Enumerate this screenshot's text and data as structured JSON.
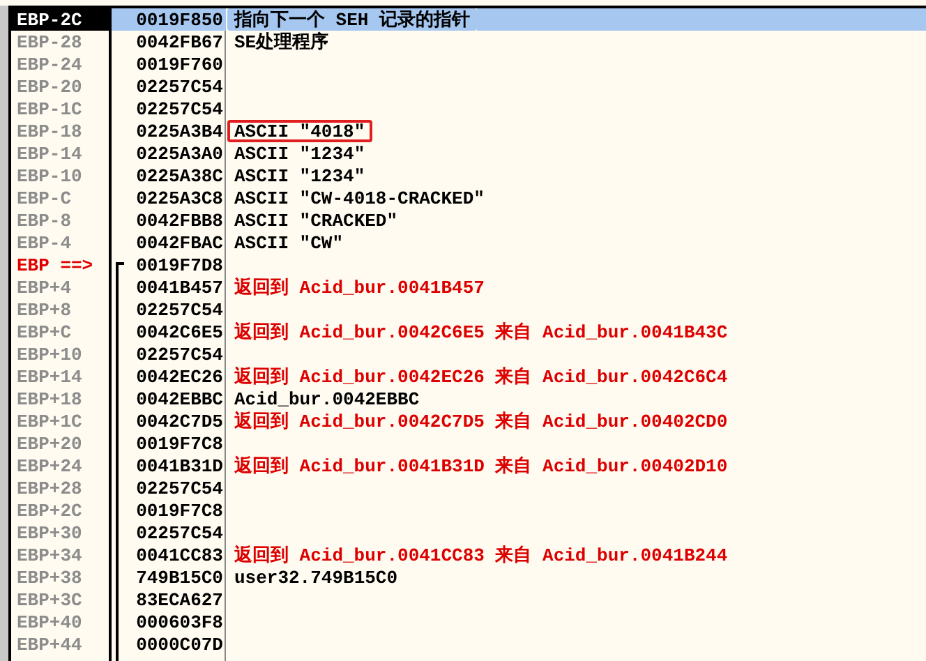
{
  "rows": [
    {
      "label": "EBP-2C",
      "value": "0019F850",
      "comment": "指向下一个 SEH 记录的指针",
      "kind": "plain",
      "selected": true,
      "current": false,
      "boxed": false,
      "frame_start": false
    },
    {
      "label": "EBP-28",
      "value": "0042FB67",
      "comment": "SE处理程序",
      "kind": "plain",
      "selected": false,
      "current": false,
      "boxed": false,
      "frame_start": false
    },
    {
      "label": "EBP-24",
      "value": "0019F760",
      "selected": false,
      "current": false,
      "frame_start": false
    },
    {
      "label": "EBP-20",
      "value": "02257C54",
      "selected": false,
      "current": false,
      "frame_start": false
    },
    {
      "label": "EBP-1C",
      "value": "02257C54",
      "selected": false,
      "current": false,
      "frame_start": false
    },
    {
      "label": "EBP-18",
      "value": "0225A3B4",
      "comment": "ASCII \"4018\"",
      "kind": "plain",
      "selected": false,
      "current": false,
      "boxed": true,
      "frame_start": false
    },
    {
      "label": "EBP-14",
      "value": "0225A3A0",
      "comment": "ASCII \"1234\"",
      "kind": "plain",
      "selected": false,
      "current": false,
      "boxed": false,
      "frame_start": false
    },
    {
      "label": "EBP-10",
      "value": "0225A38C",
      "comment": "ASCII \"1234\"",
      "kind": "plain",
      "selected": false,
      "current": false,
      "boxed": false,
      "frame_start": false
    },
    {
      "label": "EBP-C",
      "value": "0225A3C8",
      "comment": "ASCII \"CW-4018-CRACKED\"",
      "kind": "plain",
      "selected": false,
      "current": false,
      "boxed": false,
      "frame_start": false
    },
    {
      "label": "EBP-8",
      "value": "0042FBB8",
      "comment": "ASCII \"CRACKED\"",
      "kind": "plain",
      "selected": false,
      "current": false,
      "boxed": false,
      "frame_start": false
    },
    {
      "label": "EBP-4",
      "value": "0042FBAC",
      "comment": "ASCII \"CW\"",
      "kind": "plain",
      "selected": false,
      "current": false,
      "boxed": false,
      "frame_start": false
    },
    {
      "label": "EBP ==>",
      "value": "0019F7D8",
      "selected": false,
      "current": true,
      "frame_start": true
    },
    {
      "label": "EBP+4",
      "value": "0041B457",
      "comment": "返回到 Acid_bur.0041B457",
      "kind": "return",
      "selected": false,
      "current": false,
      "boxed": false,
      "frame_start": false
    },
    {
      "label": "EBP+8",
      "value": "02257C54",
      "selected": false,
      "current": false,
      "frame_start": false
    },
    {
      "label": "EBP+C",
      "value": "0042C6E5",
      "comment": "返回到 Acid_bur.0042C6E5 来自 Acid_bur.0041B43C",
      "kind": "return",
      "selected": false,
      "current": false,
      "boxed": false,
      "frame_start": false
    },
    {
      "label": "EBP+10",
      "value": "02257C54",
      "selected": false,
      "current": false,
      "frame_start": false
    },
    {
      "label": "EBP+14",
      "value": "0042EC26",
      "comment": "返回到 Acid_bur.0042EC26 来自 Acid_bur.0042C6C4",
      "kind": "return",
      "selected": false,
      "current": false,
      "boxed": false,
      "frame_start": false
    },
    {
      "label": "EBP+18",
      "value": "0042EBBC",
      "comment": "Acid_bur.0042EBBC",
      "kind": "plain",
      "selected": false,
      "current": false,
      "boxed": false,
      "frame_start": false
    },
    {
      "label": "EBP+1C",
      "value": "0042C7D5",
      "comment": "返回到 Acid_bur.0042C7D5 来自 Acid_bur.00402CD0",
      "kind": "return",
      "selected": false,
      "current": false,
      "boxed": false,
      "frame_start": false
    },
    {
      "label": "EBP+20",
      "value": "0019F7C8",
      "selected": false,
      "current": false,
      "frame_start": false
    },
    {
      "label": "EBP+24",
      "value": "0041B31D",
      "comment": "返回到 Acid_bur.0041B31D 来自 Acid_bur.00402D10",
      "kind": "return",
      "selected": false,
      "current": false,
      "boxed": false,
      "frame_start": false
    },
    {
      "label": "EBP+28",
      "value": "02257C54",
      "selected": false,
      "current": false,
      "frame_start": false
    },
    {
      "label": "EBP+2C",
      "value": "0019F7C8",
      "selected": false,
      "current": false,
      "frame_start": false
    },
    {
      "label": "EBP+30",
      "value": "02257C54",
      "selected": false,
      "current": false,
      "frame_start": false
    },
    {
      "label": "EBP+34",
      "value": "0041CC83",
      "comment": "返回到 Acid_bur.0041CC83 来自 Acid_bur.0041B244",
      "kind": "return",
      "selected": false,
      "current": false,
      "boxed": false,
      "frame_start": false
    },
    {
      "label": "EBP+38",
      "value": "749B15C0",
      "comment": "user32.749B15C0",
      "kind": "plain",
      "selected": false,
      "current": false,
      "boxed": false,
      "frame_start": false
    },
    {
      "label": "EBP+3C",
      "value": "83ECA627",
      "selected": false,
      "current": false,
      "frame_start": false
    },
    {
      "label": "EBP+40",
      "value": "000603F8",
      "selected": false,
      "current": false,
      "frame_start": false
    },
    {
      "label": "EBP+44",
      "value": "0000C07D",
      "selected": false,
      "current": false,
      "frame_start": false
    }
  ]
}
